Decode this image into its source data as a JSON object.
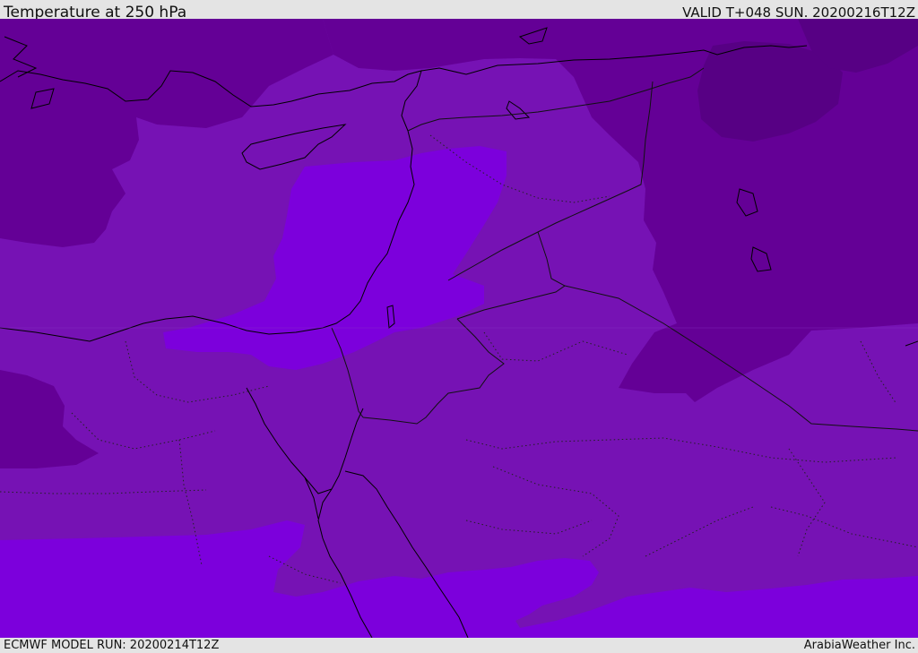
{
  "header": {
    "title": "Temperature at 250 hPa",
    "valid_time": "VALID T+048 SUN. 20200216T12Z"
  },
  "footer": {
    "model_run": "ECMWF MODEL RUN: 20200214T12Z",
    "credit": "ArabiaWeather Inc."
  },
  "colors": {
    "coldest_zone": "#570084",
    "cold_zone": "#640096",
    "mid_zone": "#7612b4",
    "warm_zone": "#7c00dc",
    "coastline": "#000000",
    "border": "#111111"
  }
}
